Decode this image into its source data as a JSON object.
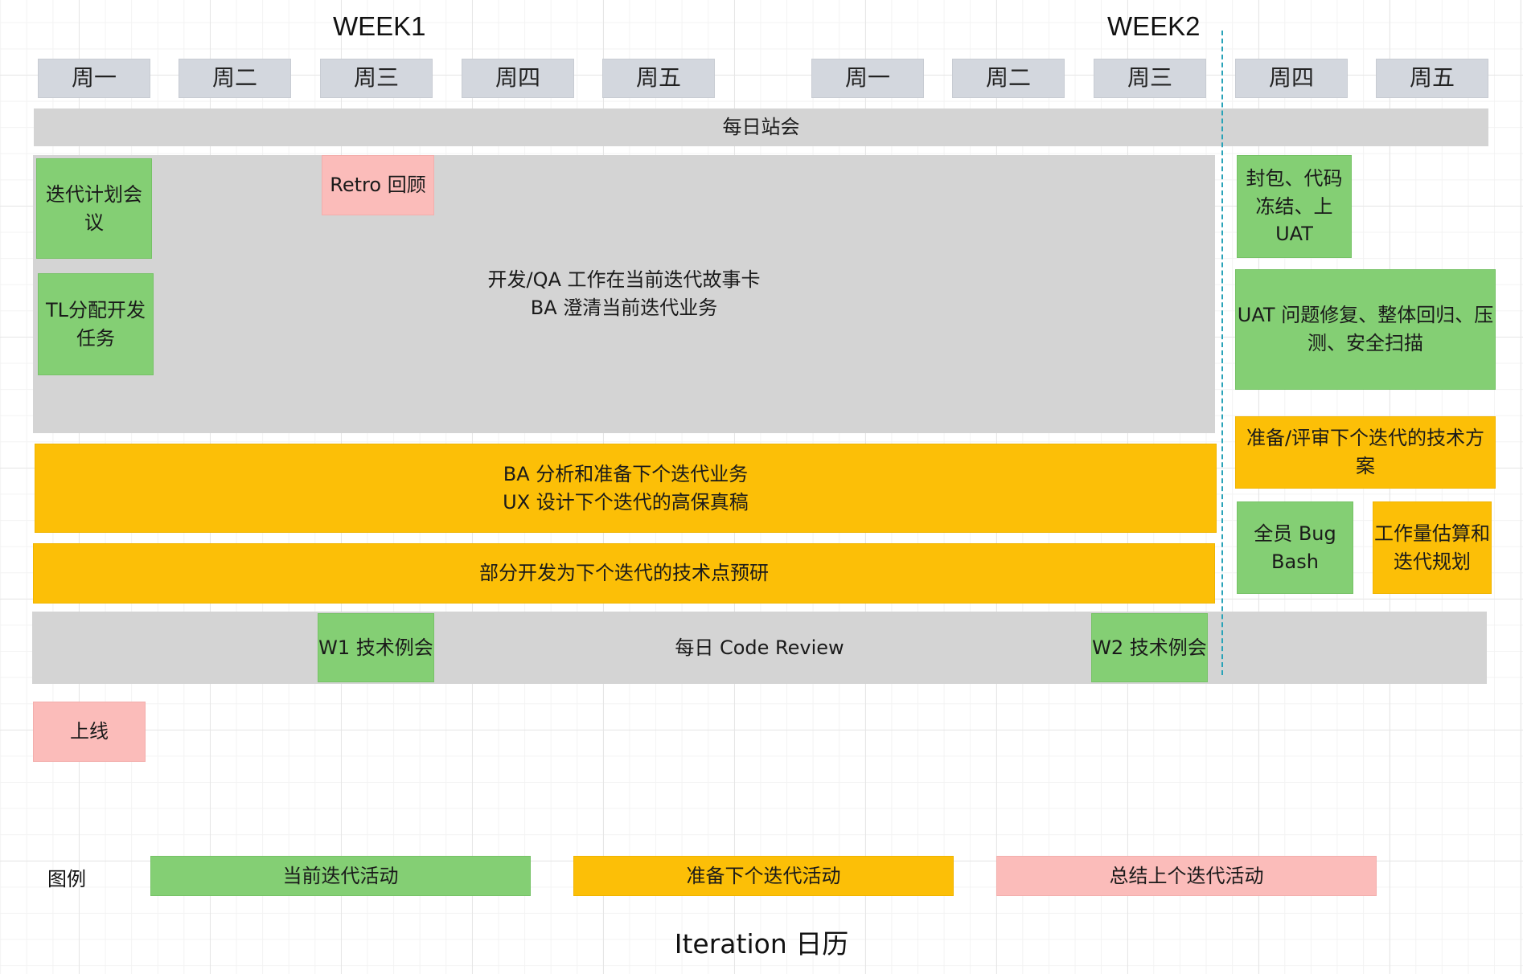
{
  "header": {
    "week1": "WEEK1",
    "week2": "WEEK2"
  },
  "days": {
    "d1": "周一",
    "d2": "周二",
    "d3": "周三",
    "d4": "周四",
    "d5": "周五",
    "d6": "周一",
    "d7": "周二",
    "d8": "周三",
    "d9": "周四",
    "d10": "周五"
  },
  "activities": {
    "standup": "每日站会",
    "dev_qa": "开发/QA 工作在当前迭代故事卡\nBA 澄清当前迭代业务",
    "iteration_planning": "迭代计划会\n议",
    "tl_assign": "TL分配开发\n任务",
    "retro": "Retro 回顾",
    "freeze_uat": "封包、代码\n冻结、上\nUAT",
    "uat_fix": "UAT 问题修复、整体回归、压\n测、安全扫描",
    "tech_review": "准备/评审下个迭代的技术方\n案",
    "ba_ux": "BA 分析和准备下个迭代业务\nUX 设计下个迭代的高保真稿",
    "research": "部分开发为下个迭代的技术点预研",
    "bug_bash": "全员 Bug\nBash",
    "estimation": "工作量估算和\n迭代规划",
    "code_review": "每日 Code Review",
    "w1_tech": "W1 技术例会",
    "w2_tech": "W2 技术例会",
    "release": "上线"
  },
  "legend": {
    "label": "图例",
    "current": "当前迭代活动",
    "next": "准备下个迭代活动",
    "previous": "总结上个迭代活动"
  },
  "colors": {
    "current": "#84cf74",
    "next": "#fcbf07",
    "previous": "#fbbcba",
    "shared": "#d4d4d4",
    "day_header": "#d3d7de",
    "divider": "#29a3b8"
  },
  "footer": {
    "title": "Iteration 日历"
  }
}
